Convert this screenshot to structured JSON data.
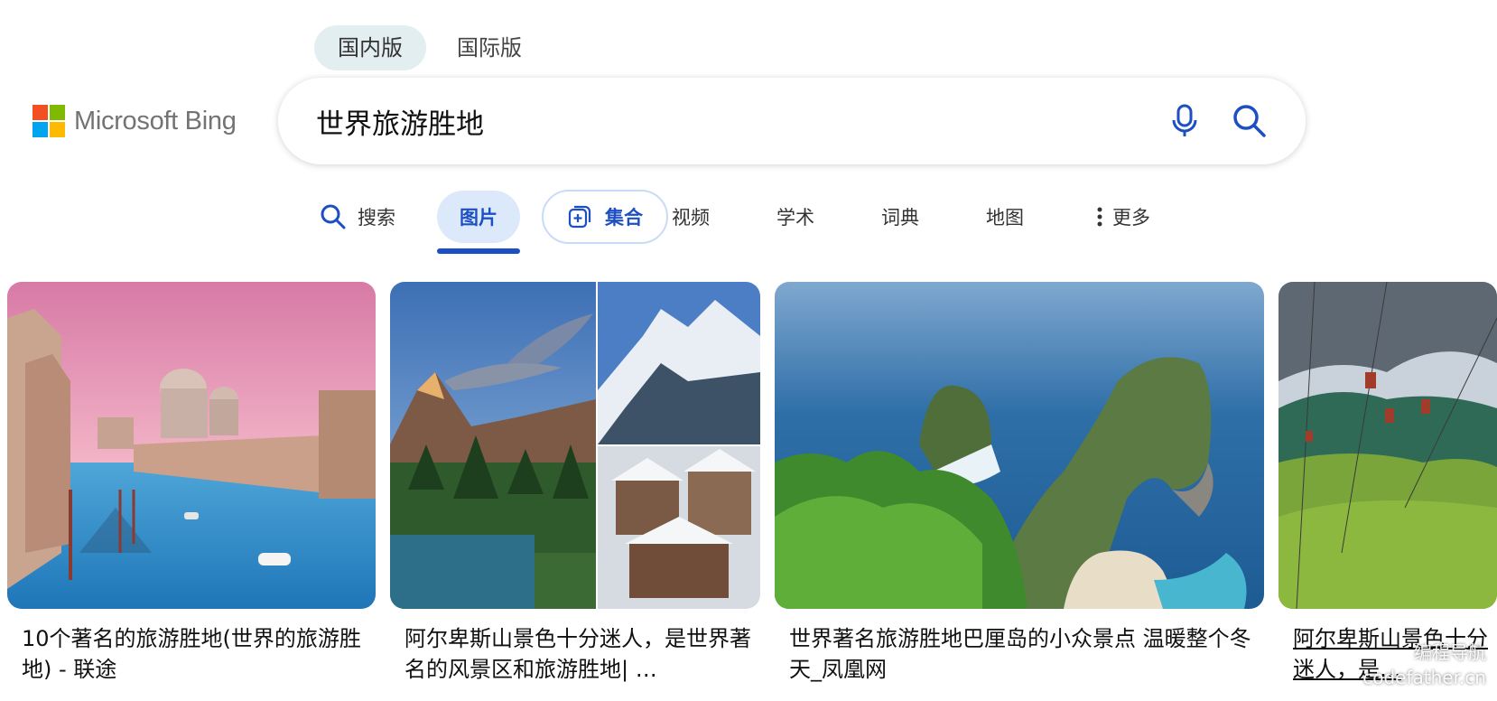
{
  "region": {
    "domestic": "国内版",
    "international": "国际版",
    "active": "domestic"
  },
  "logo": {
    "text": "Microsoft Bing",
    "colors": [
      "#f25022",
      "#7fba00",
      "#00a4ef",
      "#ffb900"
    ]
  },
  "search": {
    "query": "世界旅游胜地",
    "mic_icon": "microphone-icon",
    "search_icon": "search-icon"
  },
  "tabs": [
    {
      "label": "搜索",
      "icon": "search-icon"
    },
    {
      "label": "图片",
      "active": true
    },
    {
      "label": "集合",
      "icon": "collection-add-icon"
    },
    {
      "label": "视频"
    },
    {
      "label": "学术"
    },
    {
      "label": "词典"
    },
    {
      "label": "地图"
    },
    {
      "label": "更多",
      "icon": "vertical-dots-icon"
    }
  ],
  "results": [
    {
      "caption": "10个著名的旅游胜地(世界的旅游胜地) - 联途"
    },
    {
      "caption": "阿尔卑斯山景色十分迷人，是世界著名的风景区和旅游胜地| …"
    },
    {
      "caption": "世界著名旅游胜地巴厘岛的小众景点 温暖整个冬天_凤凰网"
    },
    {
      "caption": "阿尔卑斯山景色十分迷人，是…"
    }
  ],
  "watermark": {
    "line1": "编程导航",
    "line2": "codefather.cn"
  },
  "colors": {
    "accent": "#1d4fc4",
    "active_tab_bg": "#dce9fb",
    "region_active_bg": "#e3eef0"
  }
}
